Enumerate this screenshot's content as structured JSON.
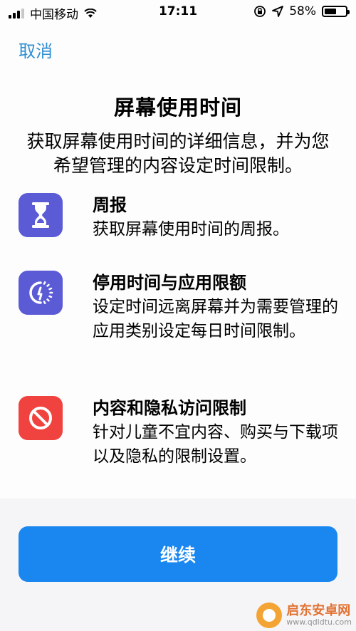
{
  "status_bar": {
    "carrier": "中国移动",
    "time": "17:11",
    "battery_percent": "58%",
    "battery_level": 0.58,
    "icons": [
      "signal-icon",
      "wifi-icon",
      "orientation-lock-icon",
      "location-icon",
      "battery-icon"
    ]
  },
  "nav": {
    "cancel_label": "取消"
  },
  "header": {
    "title": "屏幕使用时间",
    "intro": "获取屏幕使用时间的详细信息，并为您希望管理的内容设定时间限制。"
  },
  "features": [
    {
      "icon": "hourglass-icon",
      "color": "#5b5bd6",
      "title": "周报",
      "desc": "获取屏幕使用时间的周报。"
    },
    {
      "icon": "downtime-icon",
      "color": "#5b5bd6",
      "title": "停用时间与应用限额",
      "desc": "设定时间远离屏幕并为需要管理的应用类别设定每日时间限制。"
    },
    {
      "icon": "restriction-icon",
      "color": "#f0423e",
      "title": "内容和隐私访问限制",
      "desc": "针对儿童不宜内容、购买与下载项以及隐私的限制设置。"
    }
  ],
  "footer": {
    "continue_label": "继续"
  },
  "watermark": {
    "name": "启东安卓网",
    "url": "www.qdldtu.com"
  },
  "colors": {
    "accent_link": "#2f8fd3",
    "button_blue": "#1a87f0",
    "indigo": "#5b5bd6",
    "red": "#f0423e"
  }
}
